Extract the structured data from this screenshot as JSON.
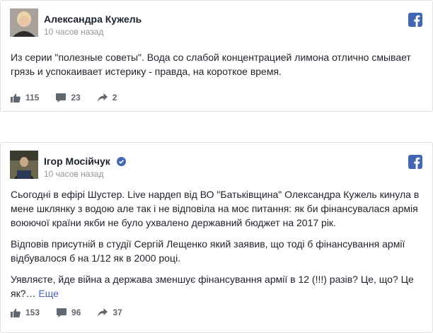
{
  "posts": [
    {
      "author": "Александра Кужель",
      "time": "10 часов назад",
      "paragraphs": [
        "Из серии \"полезные советы\". Вода со слабой концентрацией лимона отлично смывает грязь и успокаивает истерику - правда, на короткое время."
      ],
      "likes": "115",
      "comments": "23",
      "shares": "2"
    },
    {
      "author": "Ігор Мосійчук",
      "time": "10 часов назад",
      "paragraphs": [
        "Сьогодні в ефірі Шустер. Live нардеп від ВО \"Батьківщина\" Олександра Кужель кинула в мене шклянку з водою але так і не відповіла на моє питання: як би фінансувалася армія воюючої країни якби не було ухвалено державний бюджет на 2017 рік.",
        "Відповів присутній в студії Сергій Лещенко який заявив, що тоді б фінансування армії відбувалося б на 1/12 як в 2000 році.",
        "Уявляєте, йде війна а держава зменшує фінансування армії в 12 (!!!) разів? Це, що? Це як?…"
      ],
      "more": "Еще",
      "likes": "153",
      "comments": "96",
      "shares": "37"
    }
  ],
  "colors": {
    "facebook_blue": "#4267b2",
    "meta_gray": "#90949c",
    "verified": "#4267b2"
  }
}
